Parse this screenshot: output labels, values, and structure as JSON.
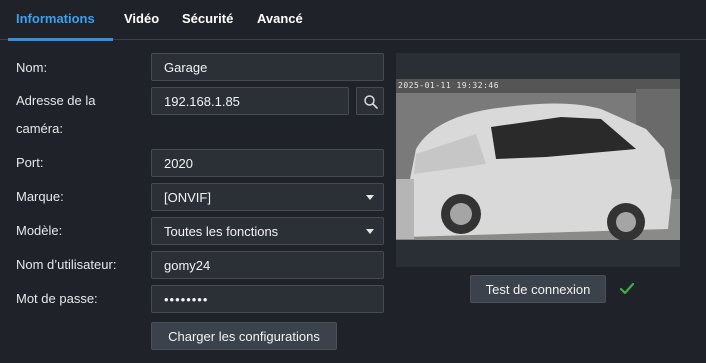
{
  "tabs": [
    {
      "label": "Informations",
      "active": true
    },
    {
      "label": "Vidéo",
      "active": false
    },
    {
      "label": "Sécurité",
      "active": false
    },
    {
      "label": "Avancé",
      "active": false
    }
  ],
  "form": {
    "name_label": "Nom:",
    "name_value": "Garage",
    "address_label_line1": "Adresse de la",
    "address_label_line2": "caméra:",
    "address_value": "192.168.1.85",
    "port_label": "Port:",
    "port_value": "2020",
    "brand_label": "Marque:",
    "brand_value": "[ONVIF]",
    "model_label": "Modèle:",
    "model_value": "Toutes les fonctions",
    "user_label": "Nom d’utilisateur:",
    "user_value": "gomy24",
    "password_label": "Mot de passe:",
    "password_value": "••••••••",
    "load_config_label": "Charger les configurations"
  },
  "preview": {
    "timestamp": "2025-01-11 19:32:46",
    "test_button_label": "Test de connexion",
    "test_status": "success"
  },
  "colors": {
    "accent": "#2f8fe0",
    "background": "#1f2228",
    "success": "#3cb043"
  },
  "icons": {
    "search": "search-icon",
    "check": "check-icon",
    "caret": "chevron-down-icon"
  }
}
